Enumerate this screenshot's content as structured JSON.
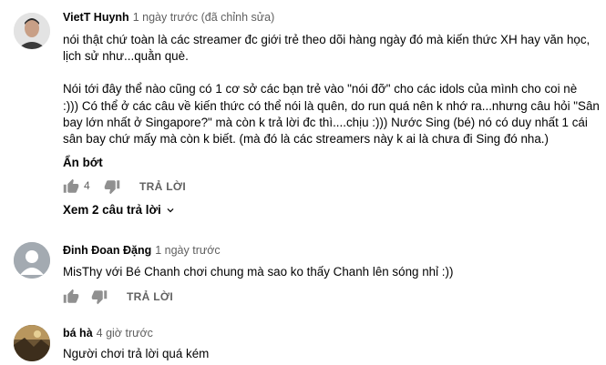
{
  "comments": [
    {
      "author": "VietT Huynh",
      "time": "1 ngày trước (đã chỉnh sửa)",
      "lines": [
        "nói thật chứ toàn là các streamer đc giới trẻ theo dõi hàng ngày đó mà kiến thức XH hay văn học,",
        "lịch sử như...quằn què.",
        "",
        "Nói tới đây thể nào cũng có 1 cơ sở các bạn trẻ vào \"nói đỡ\" cho các idols của mình cho coi nè",
        ":))) Có thể ở các câu về kiến thức có thể nói là quên, do run quá nên k nhớ ra...nhưng câu hỏi \"Sân",
        "bay lớn nhất ở Singapore?\" mà còn k trả lời đc thì....chịu :))) Nước Sing (bé) nó có duy nhất 1 cái",
        "sân bay chứ mấy mà còn k biết. (mà đó là các streamers này k ai là chưa đi Sing đó nha.)"
      ],
      "read_less": "Ẩn bớt",
      "likes": "4",
      "reply_label": "TRẢ LỜI",
      "view_replies": "Xem 2 câu trả lời"
    },
    {
      "author": "Đinh Đoan Đặng",
      "time": "1 ngày trước",
      "lines": [
        "MisThy với Bé Chanh chơi chung mà sao ko thấy Chanh lên sóng nhỉ :))"
      ],
      "reply_label": "TRẢ LỜI"
    },
    {
      "author": "bá hà",
      "time": "4 giờ trước",
      "lines": [
        "Người chơi trả lời quá kém"
      ]
    }
  ],
  "icons": {
    "like": "thumb-up-icon",
    "dislike": "thumb-down-icon",
    "expand": "chevron-down-icon"
  },
  "colors": {
    "text": "#030303",
    "secondary": "#606060",
    "icon": "#909090"
  }
}
